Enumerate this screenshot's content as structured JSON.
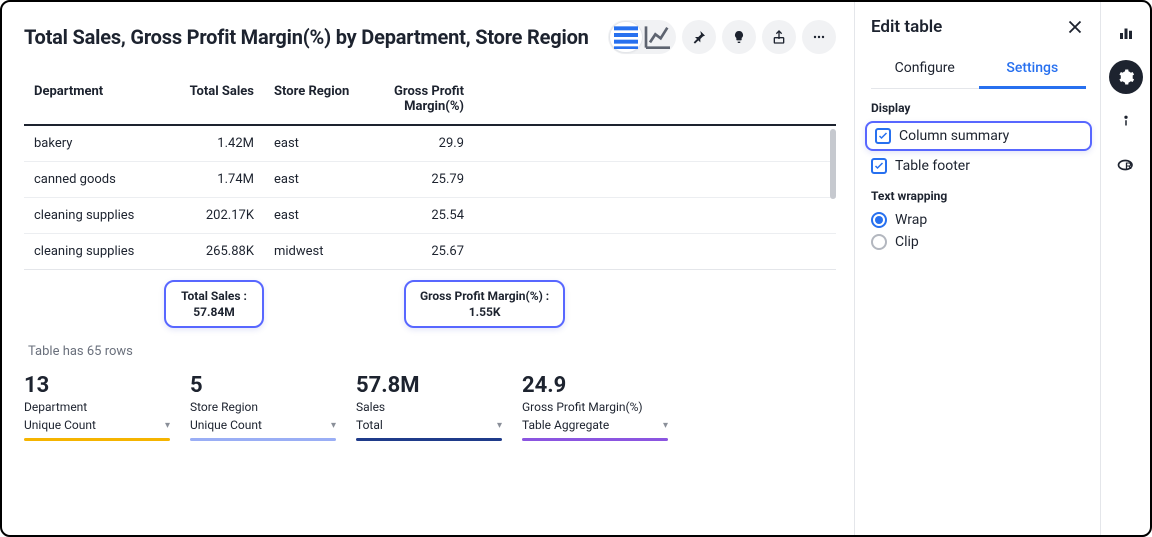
{
  "header": {
    "title": "Total Sales, Gross Profit Margin(%) by Department, Store Region"
  },
  "sidepanel": {
    "title": "Edit table",
    "tabs": {
      "configure": "Configure",
      "settings": "Settings"
    },
    "sections": {
      "display": "Display",
      "textwrap": "Text wrapping"
    },
    "display": {
      "column_summary": "Column summary",
      "table_footer": "Table footer"
    },
    "textwrap": {
      "wrap": "Wrap",
      "clip": "Clip"
    }
  },
  "table": {
    "columns": {
      "department": "Department",
      "total_sales": "Total Sales",
      "store_region": "Store Region",
      "gpm": "Gross Profit Margin(%)"
    },
    "rows": [
      {
        "department": "bakery",
        "total_sales": "1.42M",
        "store_region": "east",
        "gpm": "29.9"
      },
      {
        "department": "canned goods",
        "total_sales": "1.74M",
        "store_region": "east",
        "gpm": "25.79"
      },
      {
        "department": "cleaning supplies",
        "total_sales": "202.17K",
        "store_region": "east",
        "gpm": "25.54"
      },
      {
        "department": "cleaning supplies",
        "total_sales": "265.88K",
        "store_region": "midwest",
        "gpm": "25.67"
      }
    ],
    "row_count_text": "Table has 65 rows"
  },
  "callouts": {
    "sales": {
      "label": "Total Sales :",
      "value": "57.84M"
    },
    "gpm": {
      "label": "Gross Profit Margin(%) :",
      "value": "1.55K"
    }
  },
  "summary": [
    {
      "value": "13",
      "label": "Department",
      "agg": "Unique Count",
      "color": "#f5b400"
    },
    {
      "value": "5",
      "label": "Store Region",
      "agg": "Unique Count",
      "color": "#9aaef5"
    },
    {
      "value": "57.8M",
      "label": "Sales",
      "agg": "Total",
      "color": "#1f3b8a"
    },
    {
      "value": "24.9",
      "label": "Gross Profit Margin(%)",
      "agg": "Table Aggregate",
      "color": "#8b55e0"
    }
  ]
}
